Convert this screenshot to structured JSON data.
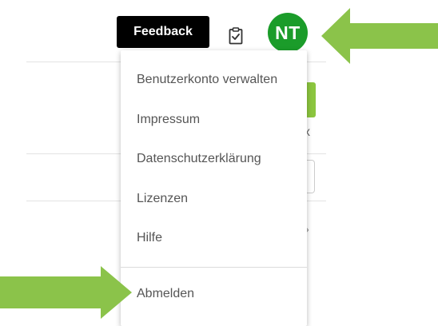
{
  "header": {
    "feedback_label": "Feedback",
    "clipboard_icon": "clipboard-check-icon",
    "avatar_initials": "NT",
    "avatar_color": "#1b9c2a"
  },
  "background": {
    "x_glyph": "x",
    "chevron_glyph": "›",
    "accent_color": "#8bc53f"
  },
  "menu": {
    "items": [
      {
        "label": "Benutzerkonto verwalten"
      },
      {
        "label": "Impressum"
      },
      {
        "label": "Datenschutzerklärung"
      },
      {
        "label": "Lizenzen"
      },
      {
        "label": "Hilfe"
      }
    ],
    "logout_label": "Abmelden"
  },
  "annotations": {
    "arrow_color": "#8bc34a",
    "arrow_icon": "annotation-arrow-icon"
  }
}
